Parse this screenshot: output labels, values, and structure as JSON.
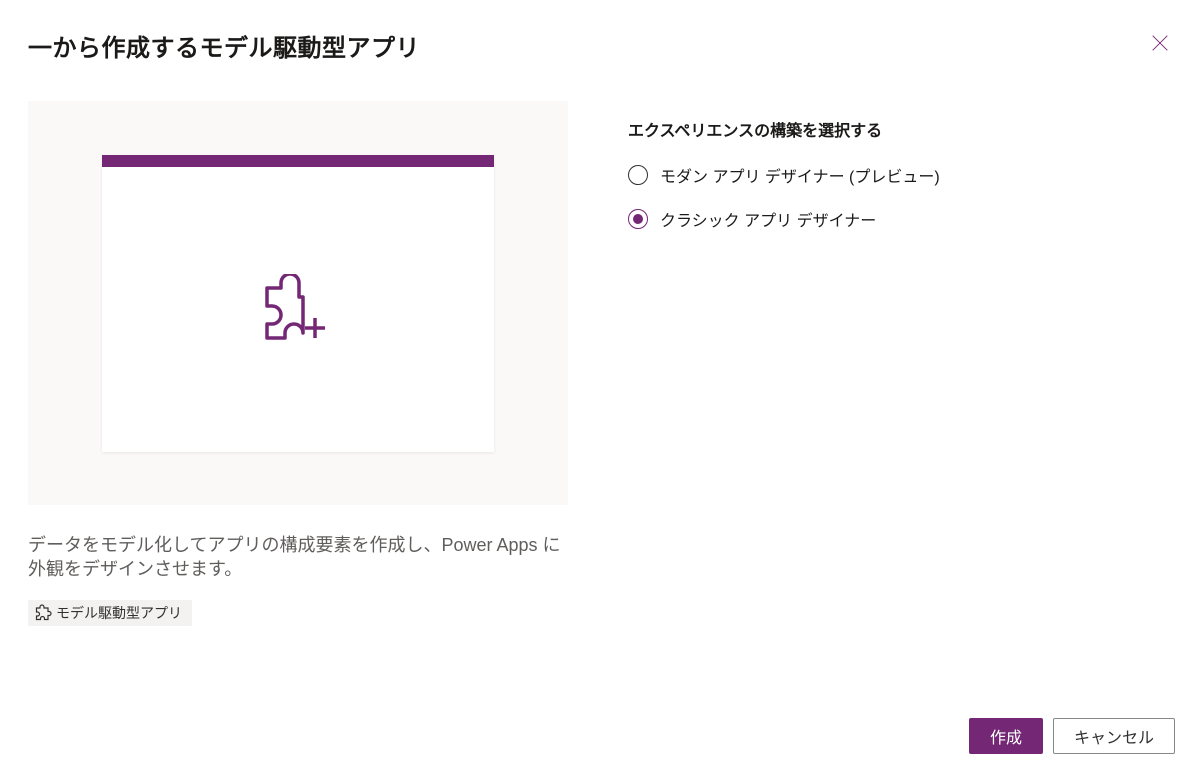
{
  "dialog": {
    "title": "一から作成するモデル駆動型アプリ",
    "description": "データをモデル化してアプリの構成要素を作成し、Power Apps に外観をデザインさせます。",
    "badge_label": "モデル駆動型アプリ"
  },
  "options": {
    "heading": "エクスペリエンスの構築を選択する",
    "items": [
      {
        "label": "モダン アプリ デザイナー (プレビュー)",
        "selected": false
      },
      {
        "label": "クラシック アプリ デザイナー",
        "selected": true
      }
    ]
  },
  "footer": {
    "primary": "作成",
    "secondary": "キャンセル"
  },
  "colors": {
    "accent": "#742774"
  }
}
